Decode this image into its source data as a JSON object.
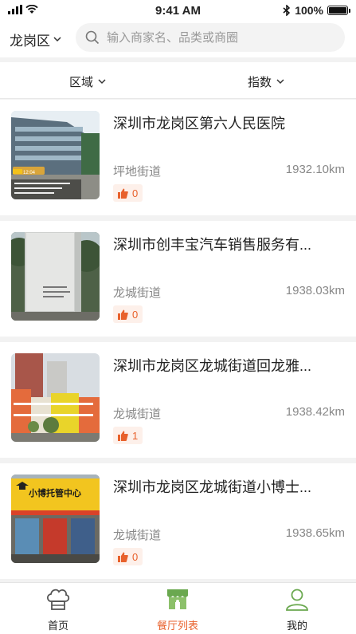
{
  "status": {
    "time": "9:41 AM",
    "battery": "100%"
  },
  "search": {
    "district": "龙岗区",
    "placeholder": "输入商家名、品类或商圈"
  },
  "filters": {
    "area": "区域",
    "index": "指数"
  },
  "items": [
    {
      "name": "深圳市龙岗区第六人民医院",
      "street": "坪地街道",
      "distance": "1932.10km",
      "likes": "0"
    },
    {
      "name": "深圳市创丰宝汽车销售服务有...",
      "street": "龙城街道",
      "distance": "1938.03km",
      "likes": "0"
    },
    {
      "name": "深圳市龙岗区龙城街道回龙雅...",
      "street": "龙城街道",
      "distance": "1938.42km",
      "likes": "1"
    },
    {
      "name": "深圳市龙岗区龙城街道小博士...",
      "street": "龙城街道",
      "distance": "1938.65km",
      "likes": "0"
    }
  ],
  "photo_text": {
    "item0_stamp": "12:04",
    "item3_sign": "小博托管中心"
  },
  "tabs": {
    "home": "首页",
    "restaurants": "餐厅列表",
    "mine": "我的"
  },
  "colors": {
    "accent": "#e8612c",
    "green": "#6aa84f",
    "background": "#f2f2f2"
  },
  "icons": {
    "search": "search-icon",
    "chevron": "chevron-down-icon",
    "like": "thumbs-up-icon",
    "home": "chef-hat-icon",
    "restaurants": "storefront-icon",
    "mine": "user-icon"
  }
}
